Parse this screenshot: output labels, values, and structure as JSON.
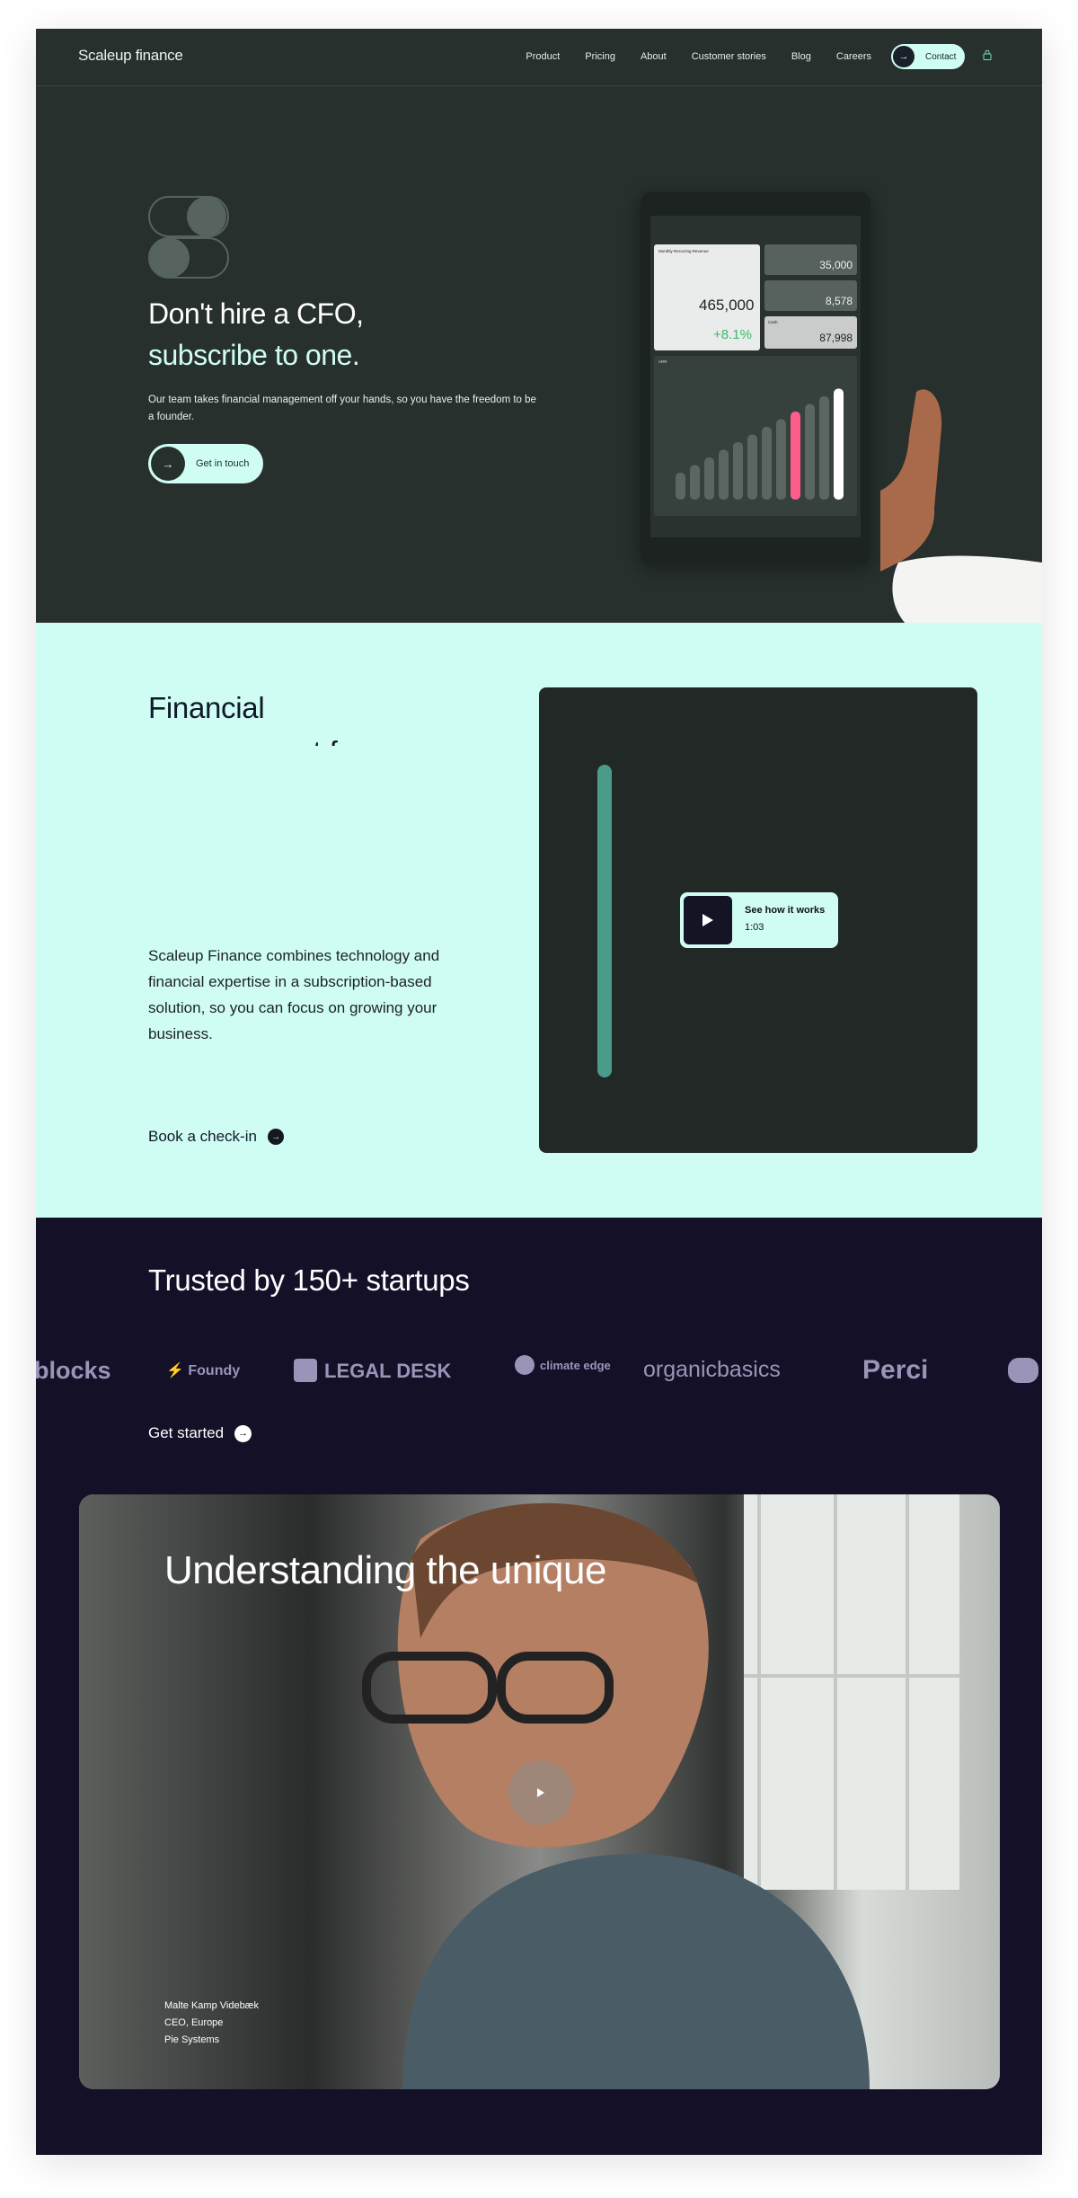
{
  "brand": {
    "name": "Scaleup finance"
  },
  "nav": {
    "items": [
      "Product",
      "Pricing",
      "About",
      "Customer stories",
      "Blog",
      "Careers"
    ],
    "contact_label": "Contact",
    "account_icon": "lock-icon"
  },
  "hero": {
    "title_line1": "Don't hire a CFO,",
    "title_line2": "subscribe to one.",
    "subtitle": "Our team takes financial management off your hands, so you have the freedom to be a founder.",
    "cta_label": "Get in touch",
    "dashboard": {
      "mrr_label": "Monthly Recurring Revenue",
      "mrr_value": "465,000",
      "mrr_change": "+8.1%",
      "card2_value": "35,000",
      "card3_value": "8,578",
      "cash_label": "Cash",
      "cash_value": "87,998",
      "chart_label": "ARR",
      "colors": {
        "accent": "#ff5c8a",
        "bars": "#5a6661",
        "highlight": "#ffffff"
      }
    }
  },
  "financial": {
    "title": "Financial",
    "title_partial": "management for",
    "body": "Scaleup Finance combines technology and financial expertise in a subscription-based solution, so you can focus on growing your business.",
    "book_label": "Book a check-in",
    "video": {
      "label": "See how it works",
      "duration": "1:03"
    }
  },
  "trusted": {
    "title": "Trusted by 150+ startups",
    "logos": [
      "blocks",
      "Foundy",
      "LEGAL DESK",
      "climate edge",
      "organicbasics",
      "Perci"
    ],
    "get_started_label": "Get started"
  },
  "testimonial": {
    "title": "Understanding the unique",
    "person": "Malte Kamp Videbæk",
    "role": "CEO, Europe",
    "company": "Pie Systems"
  },
  "colors": {
    "dark_green": "#27302d",
    "mint": "#cffdf4",
    "navy": "#141028"
  }
}
